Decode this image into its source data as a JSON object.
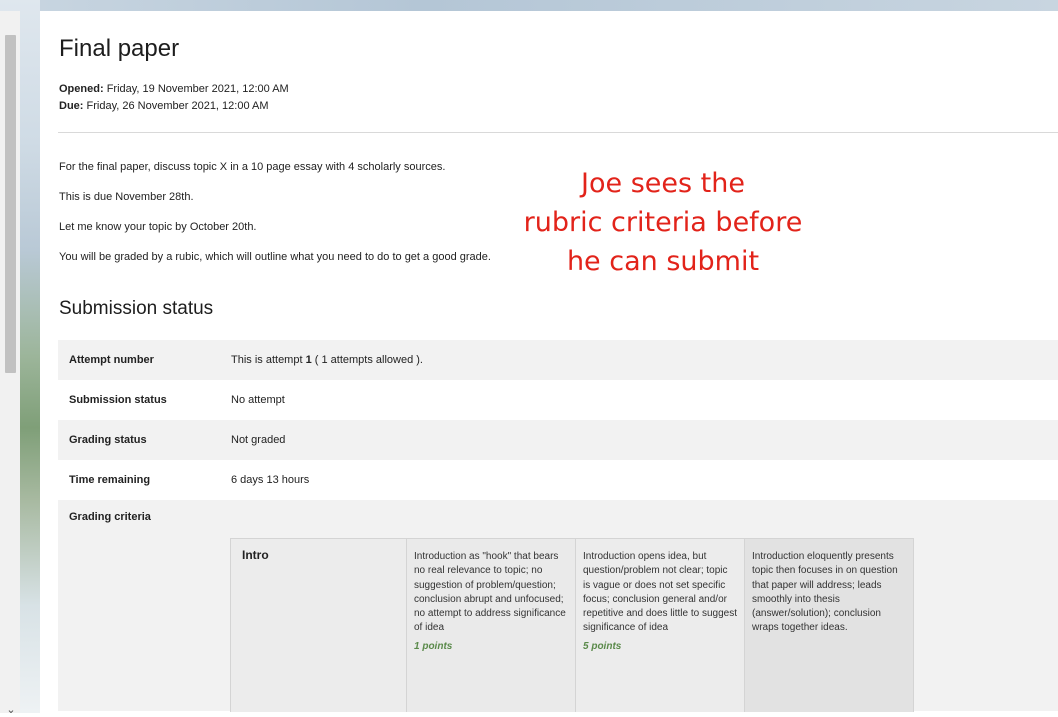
{
  "assignment": {
    "title": "Final paper",
    "opened_label": "Opened:",
    "opened_value": "Friday, 19 November 2021, 12:00 AM",
    "due_label": "Due:",
    "due_value": "Friday, 26 November 2021, 12:00 AM",
    "description": [
      "For the final paper, discuss topic X in a 10 page essay with 4 scholarly sources.",
      "This is due November 28th.",
      "Let me know your topic by October 20th.",
      "You will be graded by a rubic, which will outline what you need to do to get a good grade."
    ]
  },
  "annotation": {
    "lines": [
      "Joe sees the",
      "rubric criteria before",
      "he can submit"
    ],
    "color": "#e2231a"
  },
  "submission": {
    "heading": "Submission status",
    "rows": [
      {
        "label": "Attempt number",
        "value_pre": "This is attempt ",
        "value_bold": "1",
        "value_post": " ( 1 attempts allowed )."
      },
      {
        "label": "Submission status",
        "value": "No attempt"
      },
      {
        "label": "Grading status",
        "value": "Not graded"
      },
      {
        "label": "Time remaining",
        "value": "6 days 13 hours"
      }
    ],
    "criteria_label": "Grading criteria"
  },
  "rubric": {
    "criterion": "Intro",
    "levels": [
      {
        "description": "Introduction as \"hook\" that bears no real relevance to topic; no suggestion of problem/question; conclusion abrupt and unfocused; no attempt to address significance of idea",
        "points": "1 points"
      },
      {
        "description": "Introduction opens idea, but question/problem not clear; topic is vague or does not set specific focus; conclusion general and/or repetitive and does little to suggest significance of idea",
        "points": "5 points"
      },
      {
        "description": "Introduction eloquently presents topic then focuses in on question that paper will address; leads smoothly into thesis (answer/solution); conclusion wraps together ideas.",
        "points": ""
      }
    ]
  },
  "scrollbar": {
    "arrow_icon": "chevron-down-icon"
  }
}
